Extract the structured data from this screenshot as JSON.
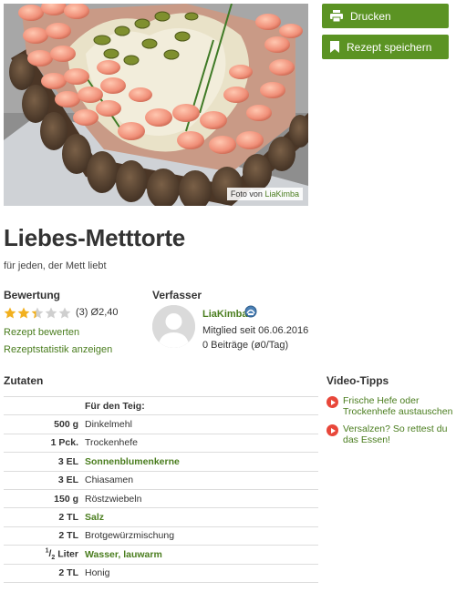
{
  "photo": {
    "credit_prefix": "Foto von",
    "credit_author": "LiaKimba"
  },
  "actions": {
    "print_label": "Drucken",
    "save_label": "Rezept speichern",
    "accent": "#5b9323"
  },
  "recipe": {
    "title": "Liebes-Metttorte",
    "subtitle": "für jeden, der Mett liebt"
  },
  "rating": {
    "heading": "Bewertung",
    "stars_filled": 2.4,
    "stars_max": 5,
    "count": "(3)",
    "average": "Ø2,40",
    "rate_link": "Rezept bewerten",
    "stats_link": "Rezeptstatistik anzeigen"
  },
  "author": {
    "heading": "Verfasser",
    "name": "LiaKimba",
    "member_since": "Mitglied seit 06.06.2016",
    "posts": "0 Beiträge (ø0/Tag)"
  },
  "ingredients": {
    "heading": "Zutaten",
    "group_label": "Für den Teig:",
    "rows": [
      {
        "amount": "500 g",
        "name": "Dinkelmehl",
        "linked": false
      },
      {
        "amount": "1 Pck.",
        "name": "Trockenhefe",
        "linked": false
      },
      {
        "amount": "3 EL",
        "name": "Sonnenblumenkerne",
        "linked": true
      },
      {
        "amount": "3 EL",
        "name": "Chiasamen",
        "linked": false
      },
      {
        "amount": "150 g",
        "name": "Röstzwiebeln",
        "linked": false
      },
      {
        "amount": "2 TL",
        "name": "Salz",
        "linked": true
      },
      {
        "amount": "2 TL",
        "name": "Brotgewürzmischung",
        "linked": false
      },
      {
        "amount_num": "1",
        "amount_den": "2",
        "amount_unit": "Liter",
        "name": "Wasser, lauwarm",
        "linked": true
      },
      {
        "amount": "2 TL",
        "name": "Honig",
        "linked": false
      }
    ]
  },
  "video_tips": {
    "heading": "Video-Tipps",
    "items": [
      {
        "label": "Frische Hefe oder Trockenhefe austauschen"
      },
      {
        "label": "Versalzen? So rettest du das Essen!"
      }
    ]
  }
}
